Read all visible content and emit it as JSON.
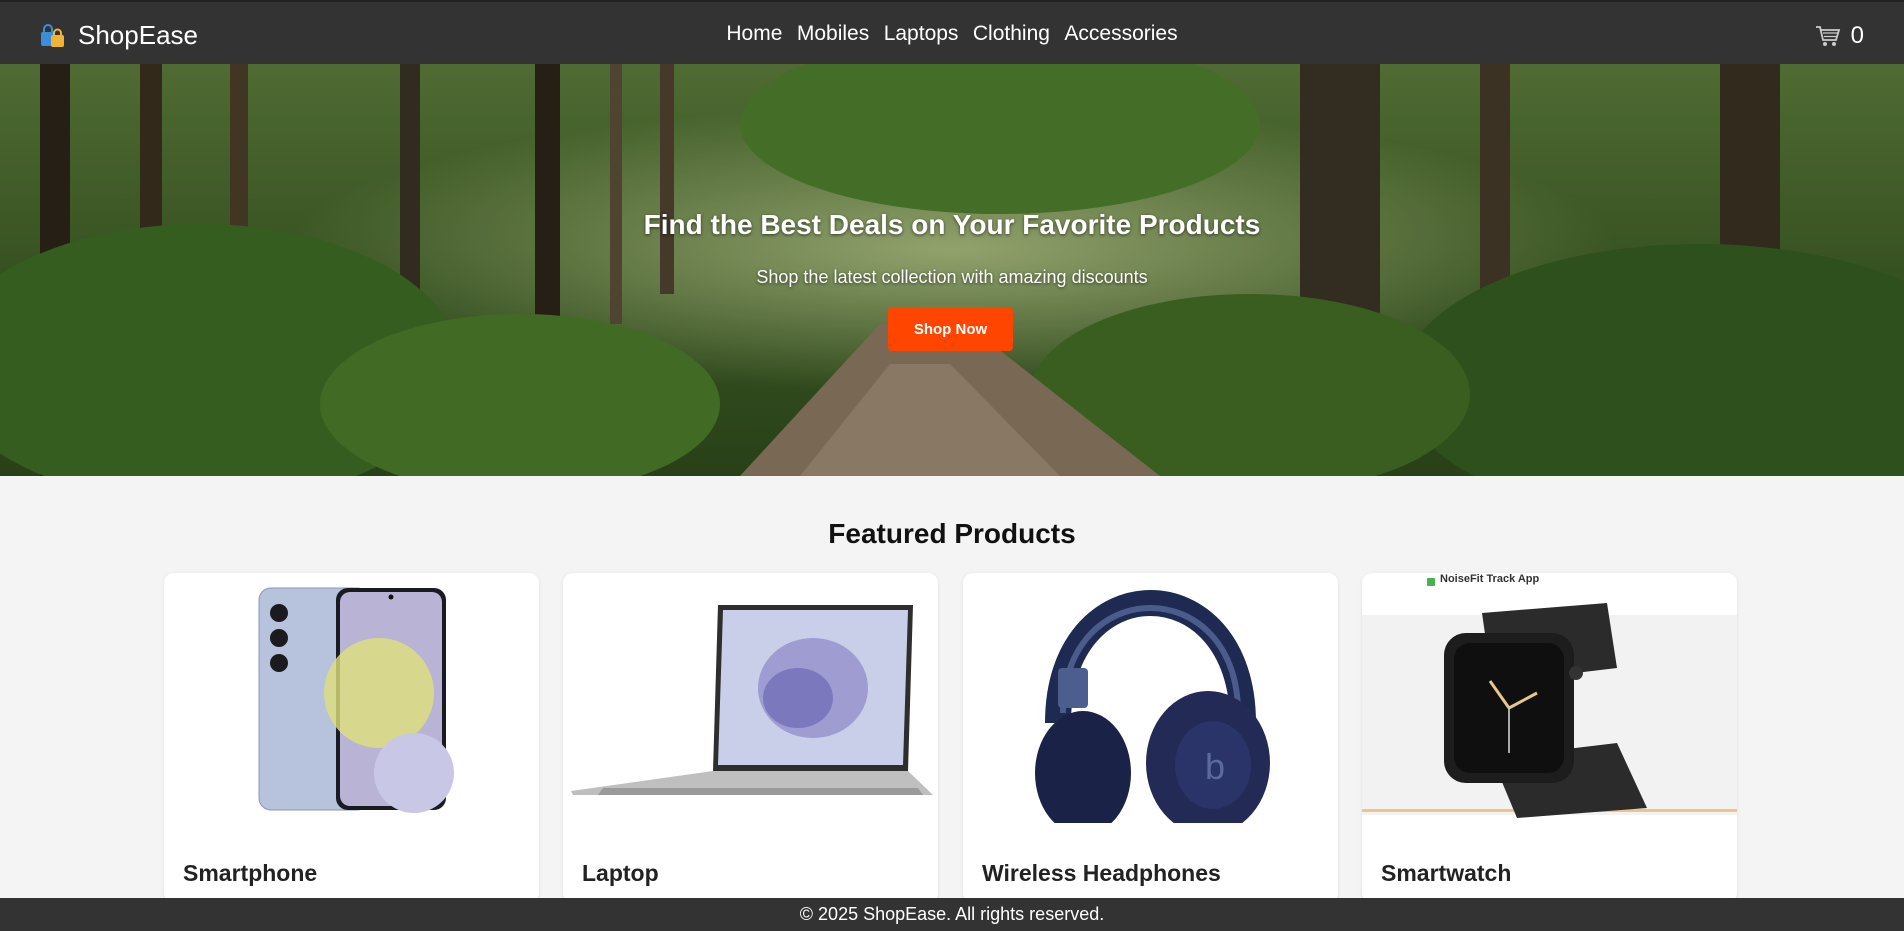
{
  "header": {
    "brand": "ShopEase",
    "brand_icon": "shopping-bags-icon",
    "nav": [
      "Home",
      "Mobiles",
      "Laptops",
      "Clothing",
      "Accessories"
    ],
    "cart_icon": "cart-icon",
    "cart_count": "0"
  },
  "hero": {
    "title": "Find the Best Deals on Your Favorite Products",
    "subtitle": "Shop the latest collection with amazing discounts",
    "cta": "Shop Now"
  },
  "featured": {
    "title": "Featured Products",
    "products": [
      {
        "name": "Smartphone"
      },
      {
        "name": "Laptop"
      },
      {
        "name": "Wireless Headphones"
      },
      {
        "name": "Smartwatch",
        "image_caption": "NoiseFit Track App"
      }
    ]
  },
  "footer": {
    "text": "© 2025 ShopEase. All rights reserved."
  },
  "colors": {
    "header_bg": "#333333",
    "accent": "#ff4500",
    "page_bg": "#f4f4f4"
  }
}
